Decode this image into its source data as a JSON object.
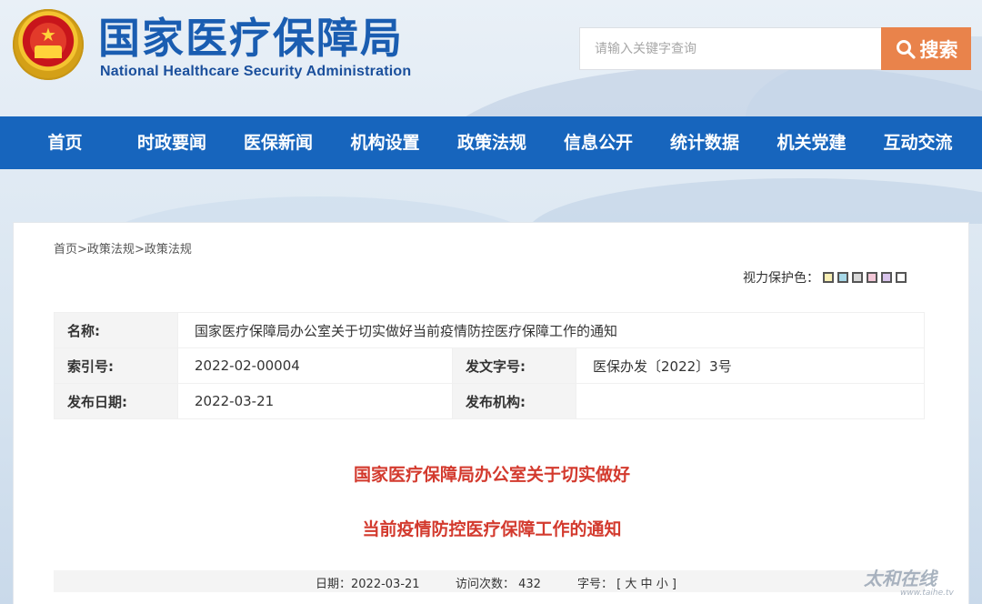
{
  "header": {
    "title_cn": "国家医疗保障局",
    "title_en": "National Healthcare Security Administration",
    "search_placeholder": "请输入关键字查询",
    "search_button": "搜索"
  },
  "nav": {
    "items": [
      "首页",
      "时政要闻",
      "医保新闻",
      "机构设置",
      "政策法规",
      "信息公开",
      "统计数据",
      "机关党建",
      "互动交流"
    ]
  },
  "breadcrumb": [
    "首页",
    ">",
    "政策法规",
    ">",
    "政策法规"
  ],
  "vision": {
    "label": "视力保护色：",
    "swatches": [
      "#f8efb4",
      "#a7d8e8",
      "#d9d9d9",
      "#f3c8d8",
      "#d9c4ec",
      "#ffffff"
    ]
  },
  "info": {
    "name_label": "名称:",
    "name_value": "国家医疗保障局办公室关于切实做好当前疫情防控医疗保障工作的通知",
    "index_label": "索引号:",
    "index_value": "2022-02-00004",
    "docno_label": "发文字号:",
    "docno_value": "医保办发〔2022〕3号",
    "date_label": "发布日期:",
    "date_value": "2022-03-21",
    "org_label": "发布机构:",
    "org_value": ""
  },
  "document": {
    "title_line1": "国家医疗保障局办公室关于切实做好",
    "title_line2": "当前疫情防控医疗保障工作的通知"
  },
  "meta": {
    "date": "日期：2022-03-21",
    "visits": "访问次数：  432",
    "font_size_label": "字号：",
    "font_open": "[",
    "font_large": "大",
    "font_medium": "中",
    "font_small": "小",
    "font_close": "]"
  },
  "watermark": {
    "text": "太和在线",
    "url": "www.taihe.tv"
  }
}
